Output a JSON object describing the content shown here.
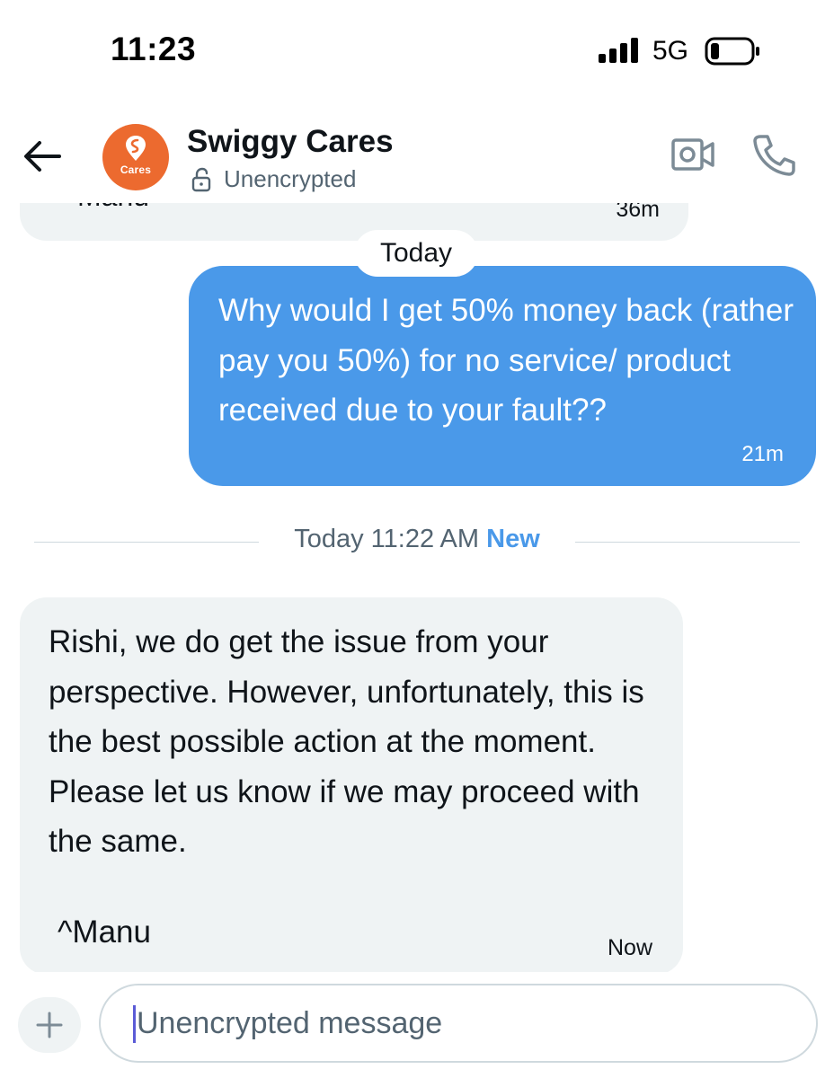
{
  "status_bar": {
    "time": "11:23",
    "network": "5G",
    "icons": [
      "signal-bars-icon",
      "battery-icon"
    ]
  },
  "header": {
    "back_icon": "arrow-left-icon",
    "avatar_text": "Cares",
    "avatar_color": "#ec6a2f",
    "title": "Swiggy Cares",
    "encryption_icon": "unlocked-padlock-icon",
    "encryption_status": "Unencrypted",
    "actions": [
      "video-call-icon",
      "phone-call-icon"
    ]
  },
  "conversation": {
    "previous_message": {
      "sender_sign": "Manu",
      "time": "36m"
    },
    "date_chip": "Today",
    "sent_message": {
      "text": "Why would I get 50% money back (rather pay you 50%) for no service/ product received due to your fault??",
      "time": "21m",
      "bubble_color": "#4a99e9"
    },
    "divider": {
      "label": "Today 11:22 AM",
      "badge": "New",
      "badge_color": "#4a99e9"
    },
    "received_message": {
      "text": "Rishi, we do get the issue from your perspective. However, unfortunately, this is the best possible action at the moment. Please let us know if we may proceed with the same.",
      "signature": "^Manu",
      "time": "Now"
    }
  },
  "composer": {
    "add_icon": "plus-icon",
    "placeholder": "Unencrypted message",
    "value": ""
  }
}
